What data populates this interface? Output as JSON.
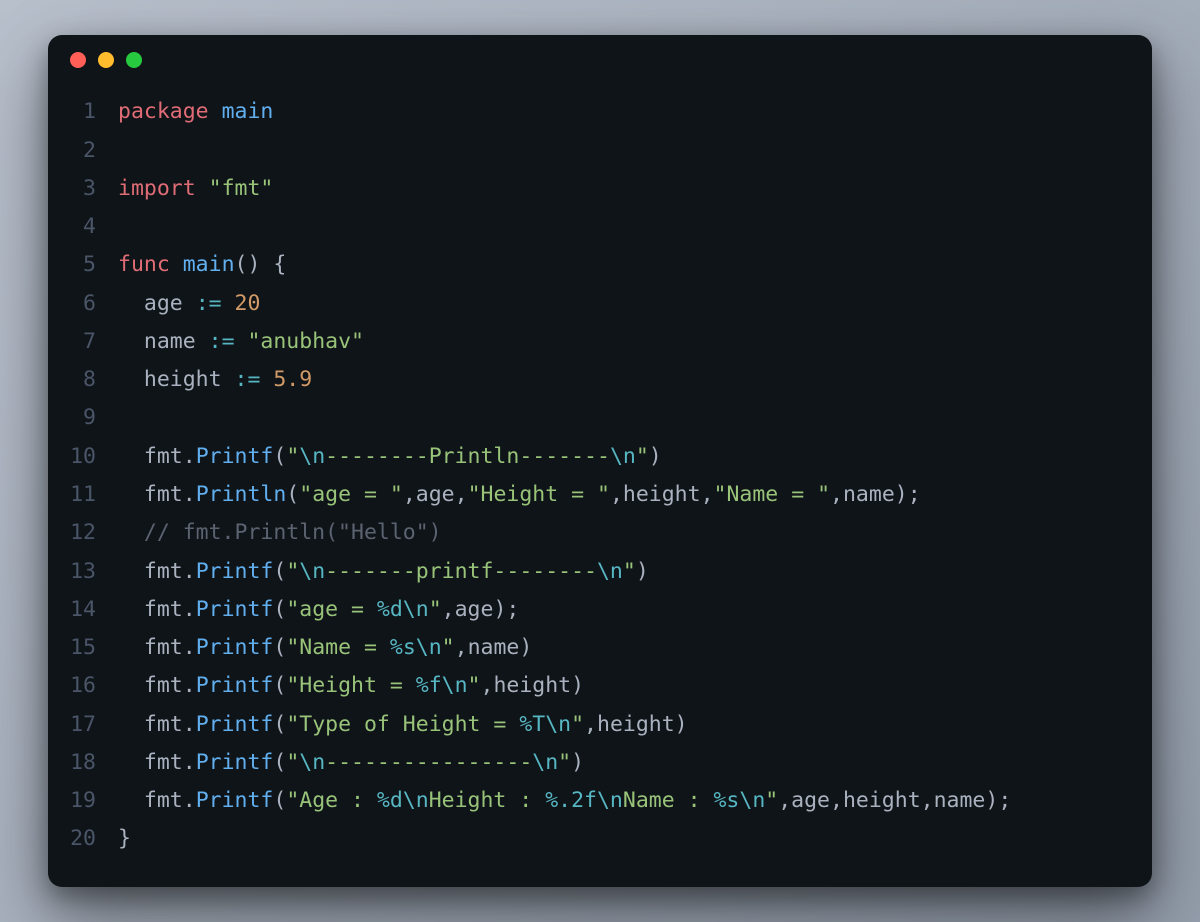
{
  "window": {
    "dots": [
      "red",
      "yellow",
      "green"
    ]
  },
  "code": {
    "lines": [
      {
        "n": "1",
        "tokens": [
          {
            "c": "kw",
            "t": "package"
          },
          {
            "c": "pun",
            "t": " "
          },
          {
            "c": "name",
            "t": "main"
          }
        ]
      },
      {
        "n": "2",
        "tokens": []
      },
      {
        "n": "3",
        "tokens": [
          {
            "c": "kw",
            "t": "import"
          },
          {
            "c": "pun",
            "t": " "
          },
          {
            "c": "str",
            "t": "\"fmt\""
          }
        ]
      },
      {
        "n": "4",
        "tokens": []
      },
      {
        "n": "5",
        "tokens": [
          {
            "c": "kw",
            "t": "func"
          },
          {
            "c": "pun",
            "t": " "
          },
          {
            "c": "name",
            "t": "main"
          },
          {
            "c": "pun",
            "t": "() {"
          }
        ]
      },
      {
        "n": "6",
        "tokens": [
          {
            "c": "pun",
            "t": "  "
          },
          {
            "c": "ident",
            "t": "age"
          },
          {
            "c": "pun",
            "t": " "
          },
          {
            "c": "op",
            "t": ":="
          },
          {
            "c": "pun",
            "t": " "
          },
          {
            "c": "num",
            "t": "20"
          }
        ]
      },
      {
        "n": "7",
        "tokens": [
          {
            "c": "pun",
            "t": "  "
          },
          {
            "c": "ident",
            "t": "name"
          },
          {
            "c": "pun",
            "t": " "
          },
          {
            "c": "op",
            "t": ":="
          },
          {
            "c": "pun",
            "t": " "
          },
          {
            "c": "str",
            "t": "\"anubhav\""
          }
        ]
      },
      {
        "n": "8",
        "tokens": [
          {
            "c": "pun",
            "t": "  "
          },
          {
            "c": "ident",
            "t": "height"
          },
          {
            "c": "pun",
            "t": " "
          },
          {
            "c": "op",
            "t": ":="
          },
          {
            "c": "pun",
            "t": " "
          },
          {
            "c": "num",
            "t": "5.9"
          }
        ]
      },
      {
        "n": "9",
        "tokens": []
      },
      {
        "n": "10",
        "tokens": [
          {
            "c": "pun",
            "t": "  "
          },
          {
            "c": "ident",
            "t": "fmt"
          },
          {
            "c": "pun",
            "t": "."
          },
          {
            "c": "fn",
            "t": "Printf"
          },
          {
            "c": "pun",
            "t": "("
          },
          {
            "c": "str",
            "t": "\""
          },
          {
            "c": "esc",
            "t": "\\n"
          },
          {
            "c": "str",
            "t": "--------Println-------"
          },
          {
            "c": "esc",
            "t": "\\n"
          },
          {
            "c": "str",
            "t": "\""
          },
          {
            "c": "pun",
            "t": ")"
          }
        ]
      },
      {
        "n": "11",
        "tokens": [
          {
            "c": "pun",
            "t": "  "
          },
          {
            "c": "ident",
            "t": "fmt"
          },
          {
            "c": "pun",
            "t": "."
          },
          {
            "c": "fn",
            "t": "Println"
          },
          {
            "c": "pun",
            "t": "("
          },
          {
            "c": "str",
            "t": "\"age = \""
          },
          {
            "c": "pun",
            "t": ","
          },
          {
            "c": "ident",
            "t": "age"
          },
          {
            "c": "pun",
            "t": ","
          },
          {
            "c": "str",
            "t": "\"Height = \""
          },
          {
            "c": "pun",
            "t": ","
          },
          {
            "c": "ident",
            "t": "height"
          },
          {
            "c": "pun",
            "t": ","
          },
          {
            "c": "str",
            "t": "\"Name = \""
          },
          {
            "c": "pun",
            "t": ","
          },
          {
            "c": "ident",
            "t": "name"
          },
          {
            "c": "pun",
            "t": ");"
          }
        ]
      },
      {
        "n": "12",
        "tokens": [
          {
            "c": "pun",
            "t": "  "
          },
          {
            "c": "cmt",
            "t": "// fmt.Println(\"Hello\")"
          }
        ]
      },
      {
        "n": "13",
        "tokens": [
          {
            "c": "pun",
            "t": "  "
          },
          {
            "c": "ident",
            "t": "fmt"
          },
          {
            "c": "pun",
            "t": "."
          },
          {
            "c": "fn",
            "t": "Printf"
          },
          {
            "c": "pun",
            "t": "("
          },
          {
            "c": "str",
            "t": "\""
          },
          {
            "c": "esc",
            "t": "\\n"
          },
          {
            "c": "str",
            "t": "-------printf--------"
          },
          {
            "c": "esc",
            "t": "\\n"
          },
          {
            "c": "str",
            "t": "\""
          },
          {
            "c": "pun",
            "t": ")"
          }
        ]
      },
      {
        "n": "14",
        "tokens": [
          {
            "c": "pun",
            "t": "  "
          },
          {
            "c": "ident",
            "t": "fmt"
          },
          {
            "c": "pun",
            "t": "."
          },
          {
            "c": "fn",
            "t": "Printf"
          },
          {
            "c": "pun",
            "t": "("
          },
          {
            "c": "str",
            "t": "\"age = "
          },
          {
            "c": "esc",
            "t": "%d\\n"
          },
          {
            "c": "str",
            "t": "\""
          },
          {
            "c": "pun",
            "t": ","
          },
          {
            "c": "ident",
            "t": "age"
          },
          {
            "c": "pun",
            "t": ");"
          }
        ]
      },
      {
        "n": "15",
        "tokens": [
          {
            "c": "pun",
            "t": "  "
          },
          {
            "c": "ident",
            "t": "fmt"
          },
          {
            "c": "pun",
            "t": "."
          },
          {
            "c": "fn",
            "t": "Printf"
          },
          {
            "c": "pun",
            "t": "("
          },
          {
            "c": "str",
            "t": "\"Name = "
          },
          {
            "c": "esc",
            "t": "%s\\n"
          },
          {
            "c": "str",
            "t": "\""
          },
          {
            "c": "pun",
            "t": ","
          },
          {
            "c": "ident",
            "t": "name"
          },
          {
            "c": "pun",
            "t": ")"
          }
        ]
      },
      {
        "n": "16",
        "tokens": [
          {
            "c": "pun",
            "t": "  "
          },
          {
            "c": "ident",
            "t": "fmt"
          },
          {
            "c": "pun",
            "t": "."
          },
          {
            "c": "fn",
            "t": "Printf"
          },
          {
            "c": "pun",
            "t": "("
          },
          {
            "c": "str",
            "t": "\"Height = "
          },
          {
            "c": "esc",
            "t": "%f\\n"
          },
          {
            "c": "str",
            "t": "\""
          },
          {
            "c": "pun",
            "t": ","
          },
          {
            "c": "ident",
            "t": "height"
          },
          {
            "c": "pun",
            "t": ")"
          }
        ]
      },
      {
        "n": "17",
        "tokens": [
          {
            "c": "pun",
            "t": "  "
          },
          {
            "c": "ident",
            "t": "fmt"
          },
          {
            "c": "pun",
            "t": "."
          },
          {
            "c": "fn",
            "t": "Printf"
          },
          {
            "c": "pun",
            "t": "("
          },
          {
            "c": "str",
            "t": "\"Type of Height = "
          },
          {
            "c": "esc",
            "t": "%T\\n"
          },
          {
            "c": "str",
            "t": "\""
          },
          {
            "c": "pun",
            "t": ","
          },
          {
            "c": "ident",
            "t": "height"
          },
          {
            "c": "pun",
            "t": ")"
          }
        ]
      },
      {
        "n": "18",
        "tokens": [
          {
            "c": "pun",
            "t": "  "
          },
          {
            "c": "ident",
            "t": "fmt"
          },
          {
            "c": "pun",
            "t": "."
          },
          {
            "c": "fn",
            "t": "Printf"
          },
          {
            "c": "pun",
            "t": "("
          },
          {
            "c": "str",
            "t": "\""
          },
          {
            "c": "esc",
            "t": "\\n"
          },
          {
            "c": "str",
            "t": "----------------"
          },
          {
            "c": "esc",
            "t": "\\n"
          },
          {
            "c": "str",
            "t": "\""
          },
          {
            "c": "pun",
            "t": ")"
          }
        ]
      },
      {
        "n": "19",
        "tokens": [
          {
            "c": "pun",
            "t": "  "
          },
          {
            "c": "ident",
            "t": "fmt"
          },
          {
            "c": "pun",
            "t": "."
          },
          {
            "c": "fn",
            "t": "Printf"
          },
          {
            "c": "pun",
            "t": "("
          },
          {
            "c": "str",
            "t": "\"Age : "
          },
          {
            "c": "esc",
            "t": "%d\\n"
          },
          {
            "c": "str",
            "t": "Height : "
          },
          {
            "c": "esc",
            "t": "%.2f\\n"
          },
          {
            "c": "str",
            "t": "Name : "
          },
          {
            "c": "esc",
            "t": "%s\\n"
          },
          {
            "c": "str",
            "t": "\""
          },
          {
            "c": "pun",
            "t": ","
          },
          {
            "c": "ident",
            "t": "age"
          },
          {
            "c": "pun",
            "t": ","
          },
          {
            "c": "ident",
            "t": "height"
          },
          {
            "c": "pun",
            "t": ","
          },
          {
            "c": "ident",
            "t": "name"
          },
          {
            "c": "pun",
            "t": ");"
          }
        ]
      },
      {
        "n": "20",
        "tokens": [
          {
            "c": "pun",
            "t": "}"
          }
        ]
      }
    ]
  }
}
